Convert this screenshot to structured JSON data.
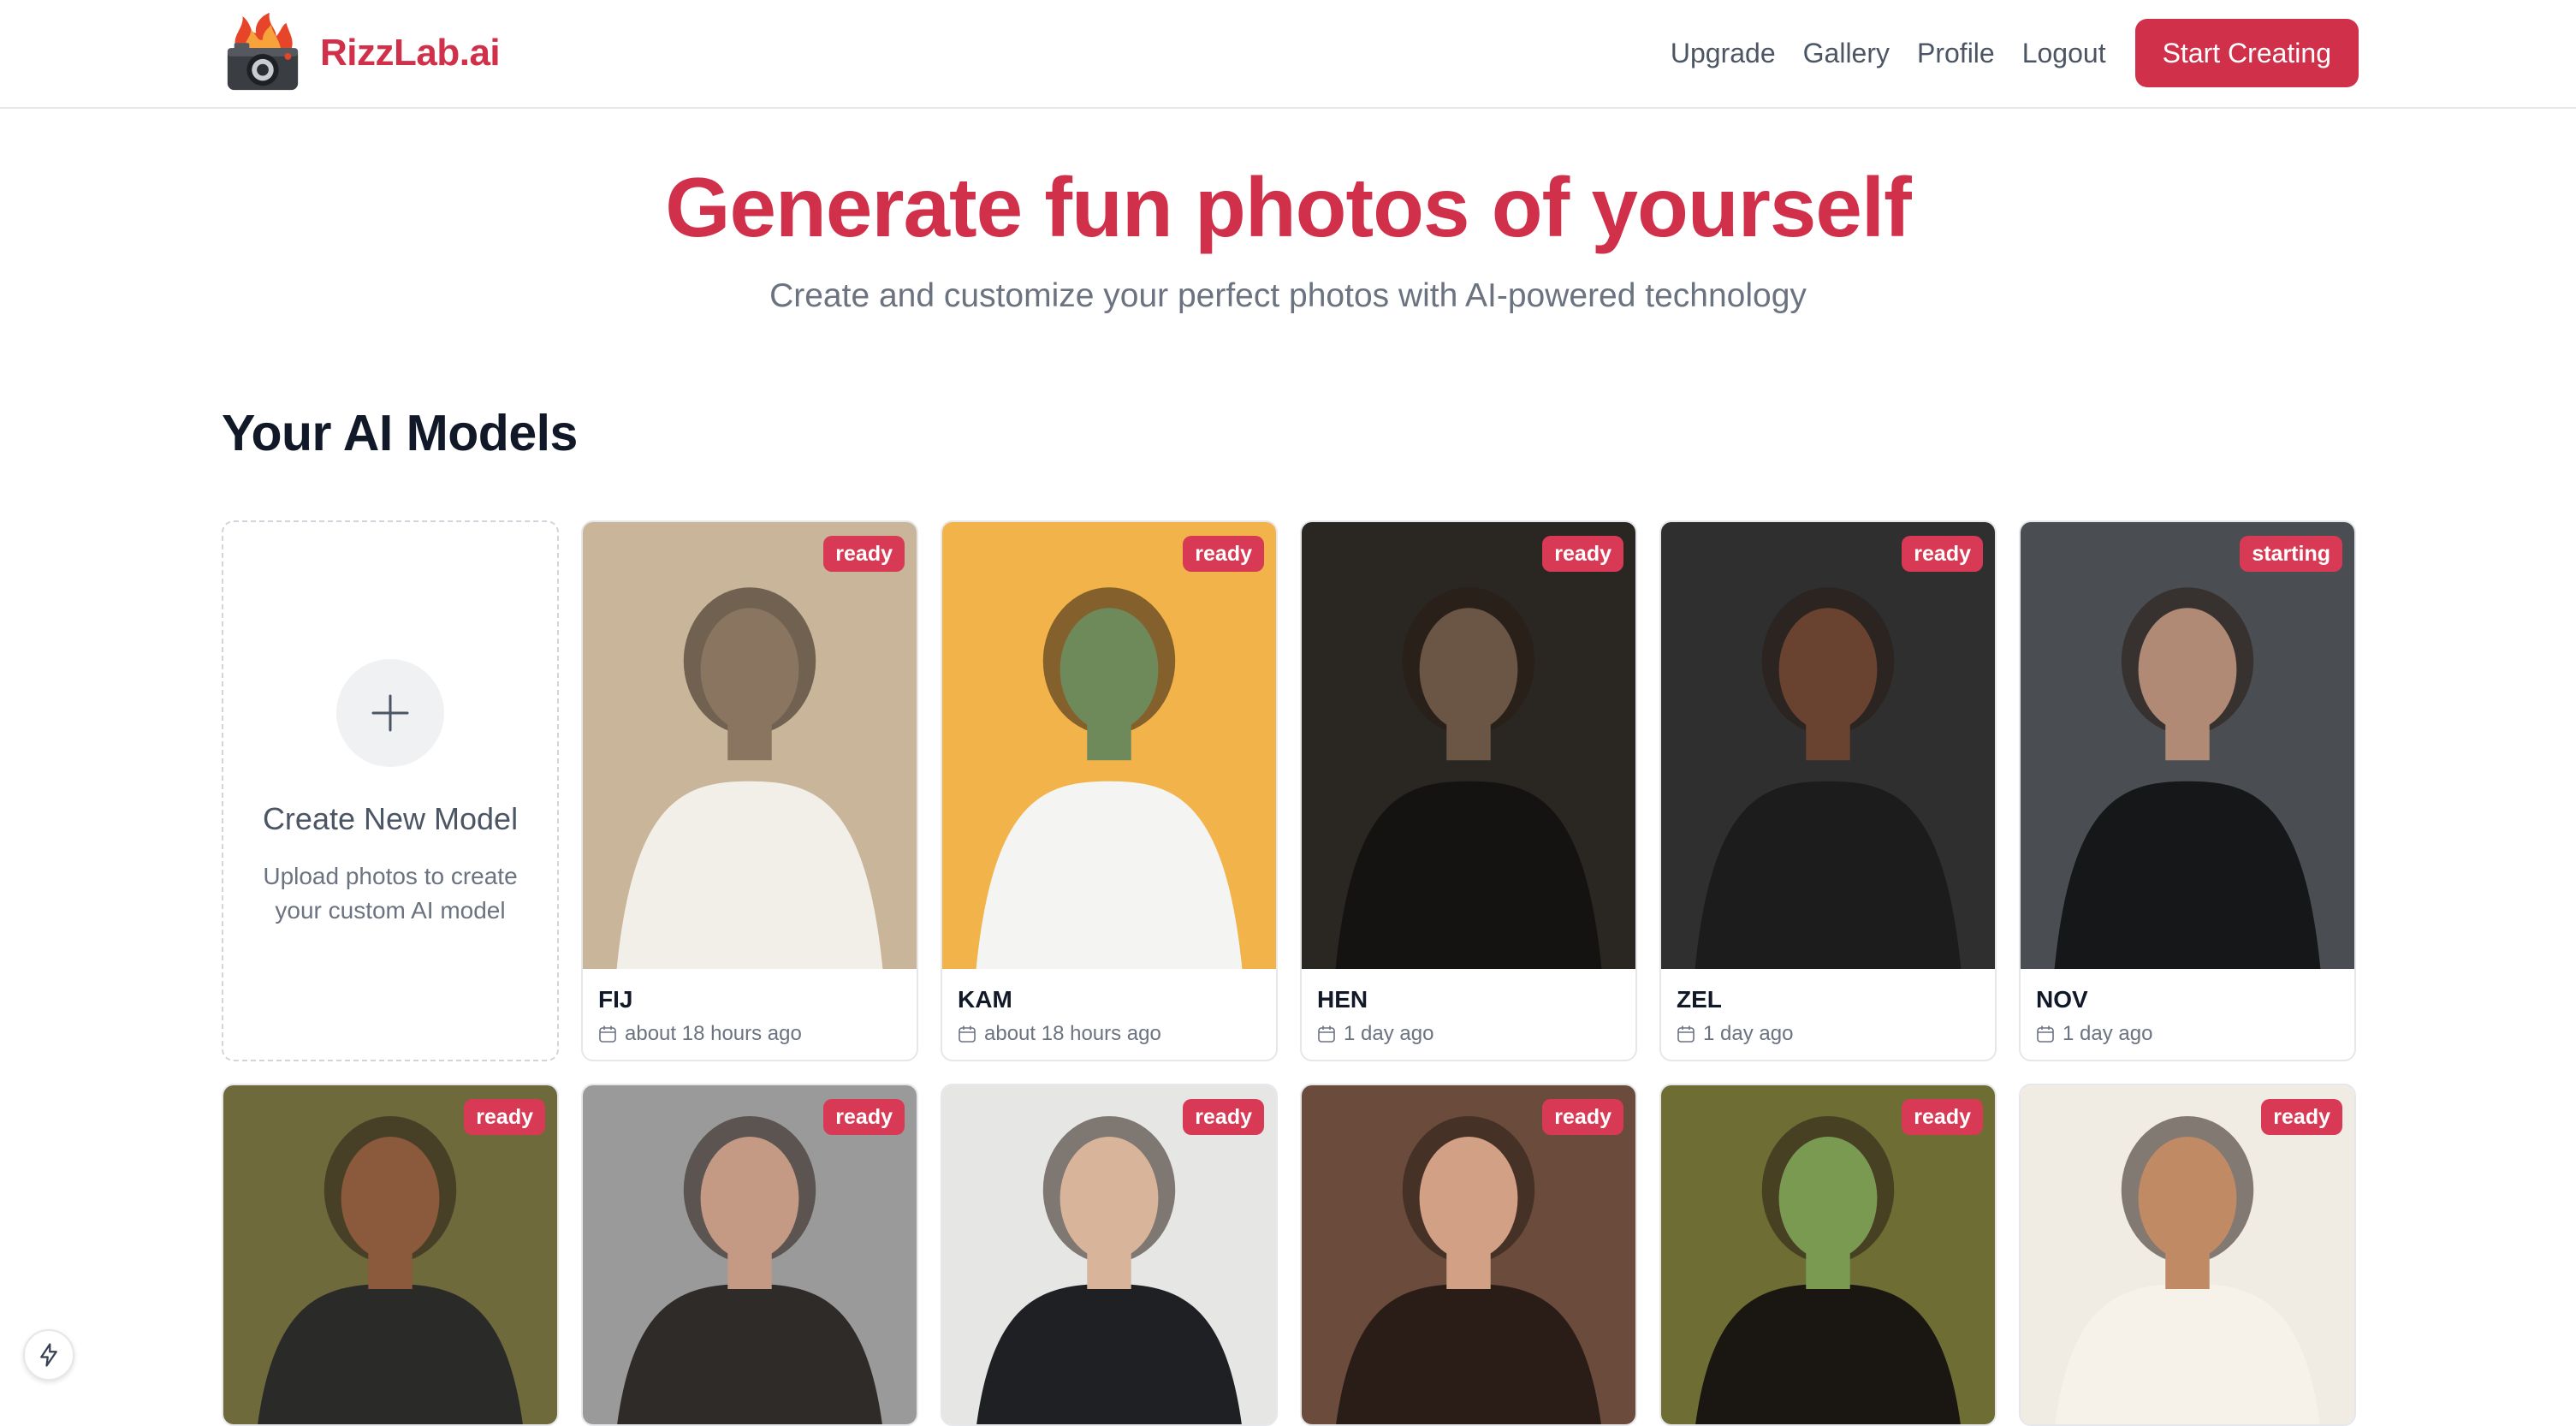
{
  "brand": {
    "name": "RizzLab.ai"
  },
  "nav": {
    "links": [
      "Upgrade",
      "Gallery",
      "Profile",
      "Logout"
    ],
    "cta": "Start Creating"
  },
  "hero": {
    "title": "Generate fun photos of yourself",
    "subtitle": "Create and customize your perfect photos with AI-powered technology"
  },
  "models_section": {
    "title": "Your AI Models",
    "create_card": {
      "title": "Create New Model",
      "description": "Upload photos to create your custom AI model"
    },
    "models": [
      {
        "name": "FIJ",
        "status": "ready",
        "date": "about 18 hours ago",
        "colors": [
          "#c9b69a",
          "#8a7560",
          "#f2eee8"
        ]
      },
      {
        "name": "KAM",
        "status": "ready",
        "date": "about 18 hours ago",
        "colors": [
          "#f2b34a",
          "#6f8a5a",
          "#f4f4f2"
        ]
      },
      {
        "name": "HEN",
        "status": "ready",
        "date": "1 day ago",
        "colors": [
          "#2a2622",
          "#6b5545",
          "#151312"
        ]
      },
      {
        "name": "ZEL",
        "status": "ready",
        "date": "1 day ago",
        "colors": [
          "#2f2f2f",
          "#6a4330",
          "#1c1c1c"
        ]
      },
      {
        "name": "NOV",
        "status": "starting",
        "date": "1 day ago",
        "colors": [
          "#4a4e52",
          "#b08a74",
          "#161719"
        ]
      }
    ],
    "more_models": [
      {
        "status": "ready",
        "colors": [
          "#6e6a3c",
          "#8b5a3c",
          "#2a2a28"
        ]
      },
      {
        "status": "ready",
        "colors": [
          "#9a9a9a",
          "#c49a84",
          "#2e2b28"
        ]
      },
      {
        "status": "ready",
        "colors": [
          "#e6e6e4",
          "#d8b49a",
          "#1e2024"
        ]
      },
      {
        "status": "ready",
        "colors": [
          "#6b4c3c",
          "#d2a084",
          "#2a1c16"
        ]
      },
      {
        "status": "ready",
        "colors": [
          "#6e6d34",
          "#7a9a52",
          "#1a1712"
        ]
      },
      {
        "status": "ready",
        "colors": [
          "#f0ece4",
          "#c08a64",
          "#f6f2ea"
        ]
      }
    ]
  },
  "accent_color": "#d0304a"
}
